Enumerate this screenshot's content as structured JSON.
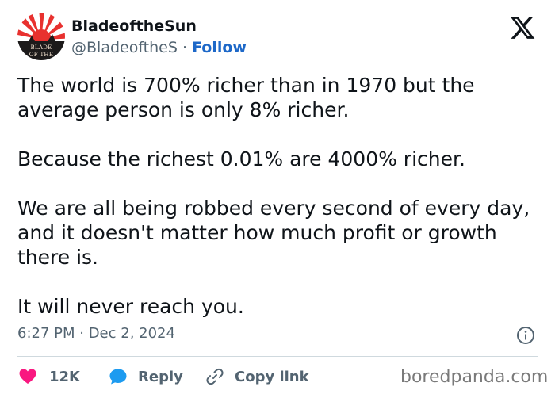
{
  "author": {
    "display_name": "BladeoftheSun",
    "handle": "@BladeoftheS",
    "separator": "·",
    "follow_label": "Follow",
    "avatar_text_line1": "BLADE",
    "avatar_text_line2": "OF THE"
  },
  "tweet": {
    "paragraphs": [
      "The world is 700% richer than in 1970 but the average person is only 8% richer.",
      "Because the richest 0.01% are 4000% richer.",
      "We are all being robbed every second of every day, and it doesn't matter how much profit or growth there is.",
      "It will never reach you."
    ],
    "timestamp": "6:27 PM · Dec 2, 2024"
  },
  "actions": {
    "like_count": "12K",
    "reply_label": "Reply",
    "copy_link_label": "Copy link"
  },
  "watermark": "boredpanda.com",
  "icons": {
    "logo": "x-logo-icon",
    "info": "info-icon",
    "like": "heart-icon",
    "reply": "speech-bubble-icon",
    "copy_link": "link-icon"
  },
  "colors": {
    "heart": "#f91880",
    "reply_bubble": "#1d9bf0",
    "follow": "#1d68c8",
    "muted_text": "#536471",
    "avatar_red": "#e8312f"
  }
}
